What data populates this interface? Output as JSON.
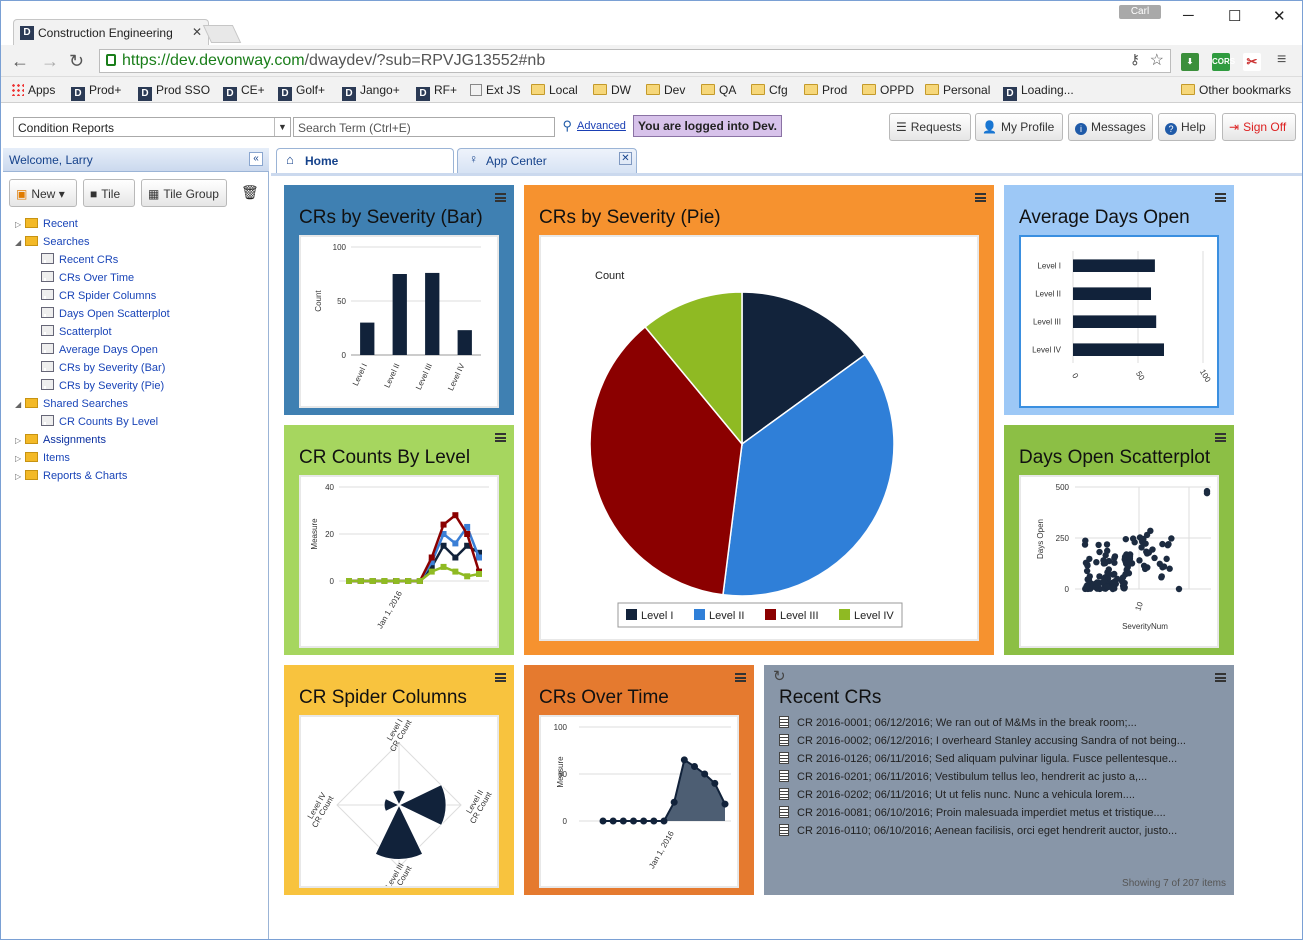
{
  "browser": {
    "tab_title": "Construction Engineering",
    "user": "Carl",
    "url_host": "https://dev.devonway.com",
    "url_path": "/dwaydev/?sub=RPVJG13552#nb",
    "extensions": [
      "CORS"
    ],
    "bookmarks": [
      "Apps",
      "Prod+",
      "Prod SSO",
      "CE+",
      "Golf+",
      "Jango+",
      "RF+",
      "Ext JS",
      "Local",
      "DW",
      "Dev",
      "QA",
      "Cfg",
      "Prod",
      "OPPD",
      "Personal",
      "Loading..."
    ],
    "other_bookmarks": "Other bookmarks"
  },
  "appbar": {
    "module_select": "Condition Reports",
    "search_placeholder": "Search Term (Ctrl+E)",
    "advanced": "Advanced",
    "logged_in": "You are logged into Dev.",
    "buttons": {
      "requests": "Requests",
      "profile": "My Profile",
      "messages": "Messages",
      "help": "Help",
      "signoff": "Sign Off"
    }
  },
  "sidebar": {
    "welcome": "Welcome, Larry",
    "new": "New",
    "tile": "Tile",
    "tile_group": "Tile Group",
    "tree": [
      "Recent",
      "Searches",
      "Recent CRs",
      "CRs Over Time",
      "CR Spider Columns",
      "Days Open Scatterplot",
      "Scatterplot",
      "Average Days Open",
      "CRs by Severity (Bar)",
      "CRs by Severity (Pie)",
      "Shared Searches",
      "CR Counts By Level",
      "Assignments",
      "Items",
      "Reports & Charts"
    ]
  },
  "content_tabs": {
    "home": "Home",
    "app_center": "App Center"
  },
  "tiles": {
    "bar": {
      "title": "CRs by Severity (Bar)",
      "color": "#3f80b2"
    },
    "pie": {
      "title": "CRs by Severity (Pie)",
      "color": "#f6922f"
    },
    "avg": {
      "title": "Average Days Open",
      "color": "#9dc8f6"
    },
    "counts": {
      "title": "CR Counts By Level",
      "color": "#a6d65f"
    },
    "scatter": {
      "title": "Days Open Scatterplot",
      "color": "#8cbf45"
    },
    "spider": {
      "title": "CR Spider Columns",
      "color": "#f8c33e"
    },
    "overtime": {
      "title": "CRs Over Time",
      "color": "#e57a2f"
    },
    "recent": {
      "title": "Recent CRs",
      "color": "#8896a8",
      "rows": [
        "CR 2016-0001; 06/12/2016; We ran out of M&Ms in the break room;...",
        "CR 2016-0002; 06/12/2016; I overheard Stanley accusing Sandra of not being...",
        "CR 2016-0126; 06/11/2016; Sed aliquam pulvinar ligula. Fusce pellentesque...",
        "CR 2016-0201; 06/11/2016; Vestibulum tellus leo, hendrerit ac justo a,...",
        "CR 2016-0202; 06/11/2016; Ut ut felis nunc. Nunc a vehicula lorem....",
        "CR 2016-0081; 06/10/2016; Proin malesuada imperdiet metus et tristique....",
        "CR 2016-0110; 06/10/2016; Aenean facilisis, orci eget hendrerit auctor, justo..."
      ],
      "footer": "Showing 7 of 207 items"
    }
  },
  "chart_data": [
    {
      "id": "bar",
      "type": "bar",
      "categories": [
        "Level I",
        "Level II",
        "Level III",
        "Level IV"
      ],
      "values": [
        30,
        75,
        76,
        23
      ],
      "ylabel": "Count",
      "ylim": [
        0,
        100
      ],
      "yticks": [
        0,
        50,
        100
      ],
      "color": "#11223a"
    },
    {
      "id": "pie",
      "type": "pie",
      "title": "Count",
      "categories": [
        "Level I",
        "Level II",
        "Level III",
        "Level IV"
      ],
      "values": [
        15,
        37,
        37,
        11
      ],
      "colors": [
        "#12233b",
        "#2f7fd8",
        "#8b0000",
        "#8fba23"
      ],
      "legend": "bottom"
    },
    {
      "id": "avg",
      "type": "bar",
      "orientation": "horizontal",
      "categories": [
        "Level I",
        "Level II",
        "Level III",
        "Level IV"
      ],
      "values": [
        63,
        60,
        64,
        70
      ],
      "xlim": [
        0,
        100
      ],
      "xticks": [
        0,
        50,
        100
      ],
      "color": "#11223a"
    },
    {
      "id": "counts",
      "type": "line",
      "ylabel": "Measure",
      "xtick": "Jan 1, 2016",
      "ylim": [
        0,
        40
      ],
      "yticks": [
        0,
        20,
        40
      ],
      "series": [
        {
          "color": "#11223a",
          "values": [
            0,
            0,
            0,
            0,
            0,
            0,
            0,
            6,
            15,
            10,
            15,
            12
          ]
        },
        {
          "color": "#3b7fd6",
          "values": [
            0,
            0,
            0,
            0,
            0,
            0,
            0,
            8,
            20,
            16,
            23,
            10
          ]
        },
        {
          "color": "#8b0000",
          "values": [
            0,
            0,
            0,
            0,
            0,
            0,
            0,
            10,
            24,
            28,
            20,
            4
          ]
        },
        {
          "color": "#8fba23",
          "values": [
            0,
            0,
            0,
            0,
            0,
            0,
            0,
            4,
            6,
            4,
            2,
            3
          ]
        }
      ]
    },
    {
      "id": "scatter",
      "type": "scatter",
      "ylabel": "Days Open",
      "xlabel": "SeverityNum",
      "yticks": [
        0,
        250,
        500
      ],
      "xtick": "10",
      "ylim": [
        0,
        500
      ],
      "color": "#1c2b40"
    },
    {
      "id": "spider",
      "type": "radar",
      "categories": [
        "Level I",
        "Level II",
        "Level III",
        "Level IV"
      ],
      "values": [
        12,
        38,
        44,
        12
      ],
      "axis_label": "CR Count",
      "color": "#11223a"
    },
    {
      "id": "overtime",
      "type": "area",
      "ylabel": "Measure",
      "xtick": "Jan 1, 2016",
      "ylim": [
        0,
        100
      ],
      "yticks": [
        0,
        50,
        100
      ],
      "values": [
        0,
        0,
        0,
        0,
        0,
        0,
        0,
        20,
        65,
        58,
        50,
        40,
        18
      ],
      "color": "#3a4c62"
    }
  ]
}
